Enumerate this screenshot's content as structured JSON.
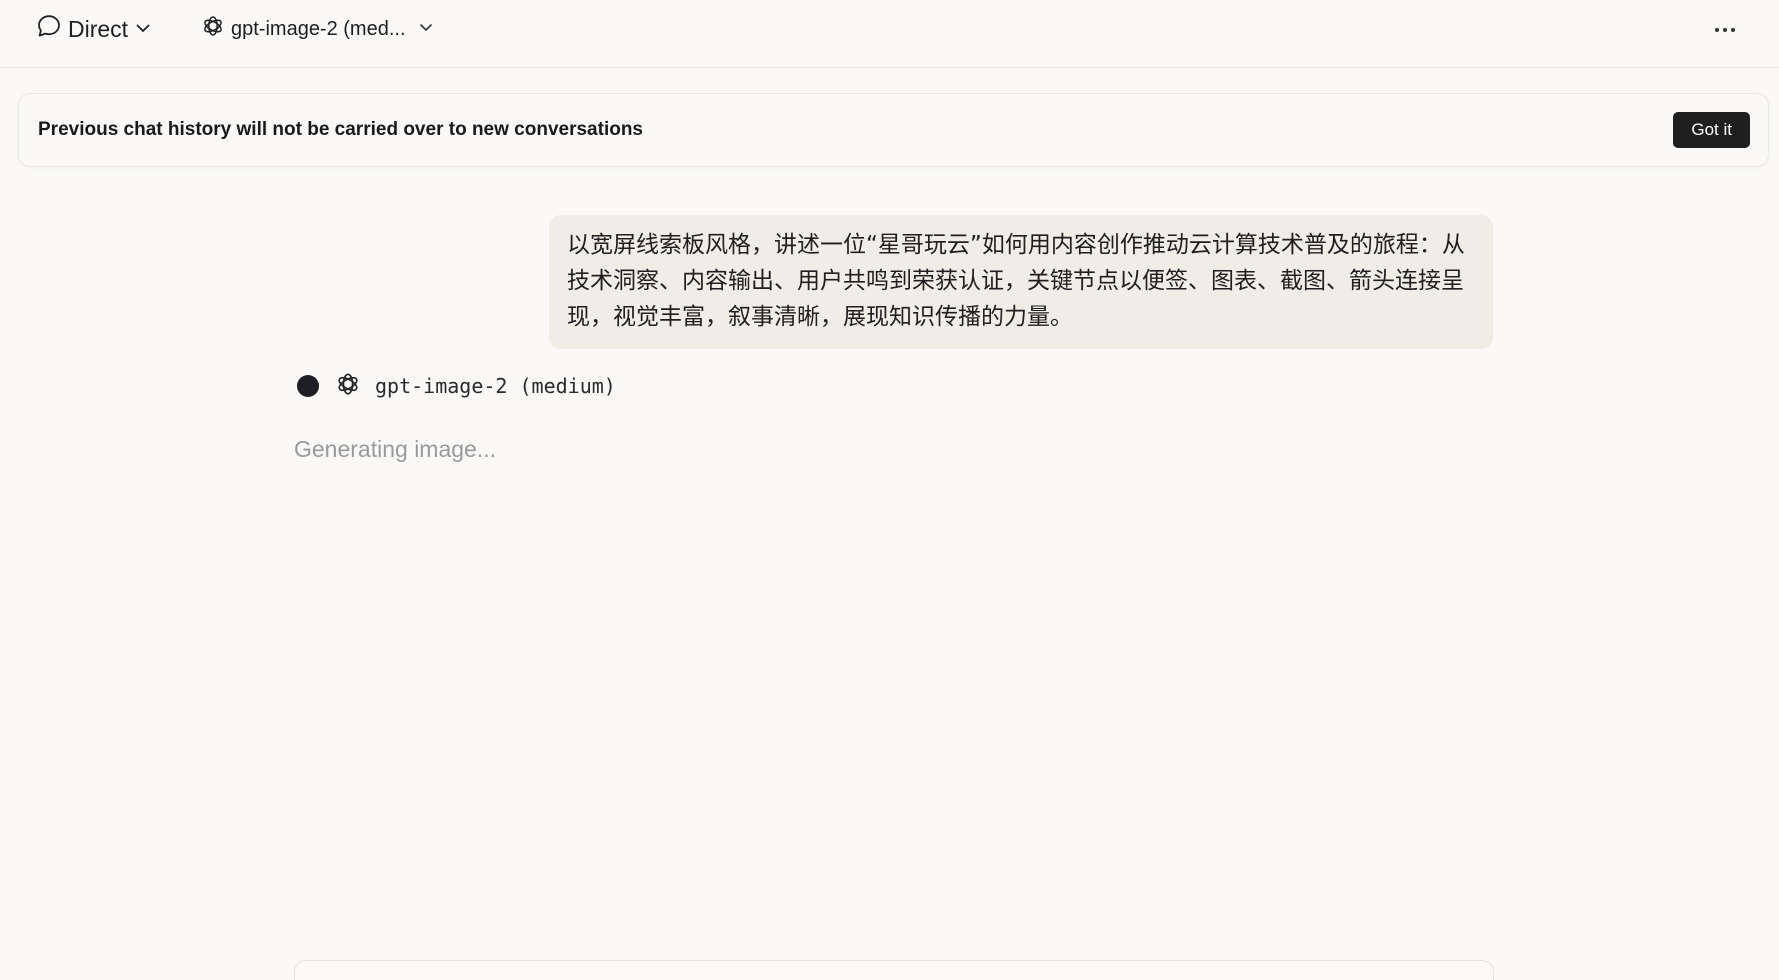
{
  "topbar": {
    "mode_label": "Direct",
    "model_label": "gpt-image-2 (med...",
    "icons": {
      "mode": "chat-bubble-icon",
      "model": "openai-logo-icon",
      "chevron": "chevron-down-icon",
      "more": "more-horizontal-icon"
    }
  },
  "notice": {
    "text": "Previous chat history will not be carried over to new conversations",
    "button_label": "Got it"
  },
  "conversation": {
    "user_message": "以宽屏线索板风格，讲述一位“星哥玩云”如何用内容创作推动云计算技术普及的旅程：从技术洞察、内容输出、用户共鸣到荣获认证，关键节点以便签、图表、截图、箭头连接呈现，视觉丰富，叙事清晰，展现知识传播的力量。",
    "assistant": {
      "model_name": "gpt-image-2 (medium)",
      "status_text": "Generating image..."
    }
  },
  "colors": {
    "background": "#faf9f7",
    "user_bubble": "#f0ece6",
    "primary_button": "#1f1f1f",
    "muted_text": "#9a9a9a"
  }
}
